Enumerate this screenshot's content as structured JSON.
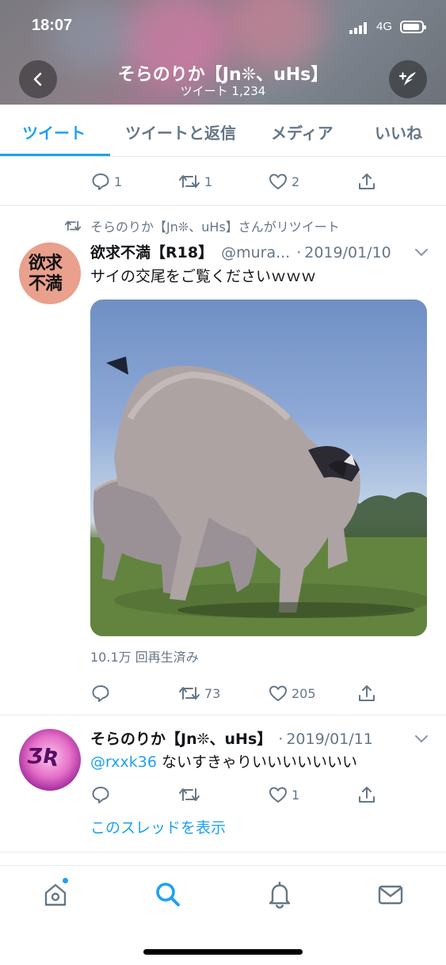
{
  "status_bar": {
    "time": "18:07",
    "network": "4G"
  },
  "header": {
    "title": "そらのりか【Jn❊、uHs】",
    "subtitle": "ツイート 1,234",
    "back_icon": "chevron-left-icon",
    "compose_icon": "compose-tweet-icon"
  },
  "tabs": [
    {
      "label": "ツイート",
      "active": true
    },
    {
      "label": "ツイートと返信",
      "active": false
    },
    {
      "label": "メディア",
      "active": false
    },
    {
      "label": "いいね",
      "active": false
    }
  ],
  "tweet0": {
    "replies": "1",
    "retweets": "1",
    "likes": "2"
  },
  "tweet1": {
    "retweeted_by": "そらのりか【Jn❊、uHs】さんがリツイート",
    "avatar_text": "欲求不満",
    "name": "欲求不満【R18】",
    "handle": "@mura...",
    "date": "2019/01/10",
    "text": "サイの交尾をご覧くださいｗｗｗ",
    "views": "10.1万 回再生済み",
    "replies": "",
    "retweets": "73",
    "likes": "205"
  },
  "tweet2": {
    "avatar_text": "ƷƦ",
    "name": "そらのりか【Jn❊、uHs】",
    "date": "2019/01/11",
    "mention": "@rxxk36",
    "text": " ないすきゃりいいいいいいい",
    "replies": "",
    "retweets": "",
    "likes": "1",
    "thread_link": "このスレッドを表示"
  },
  "separator_dot": "·",
  "colors": {
    "accent": "#1da1f2",
    "secondary_text": "#657786",
    "primary_text": "#14171a"
  },
  "bottom_nav": [
    "home-icon",
    "search-icon",
    "notifications-bell-icon",
    "messages-envelope-icon"
  ]
}
